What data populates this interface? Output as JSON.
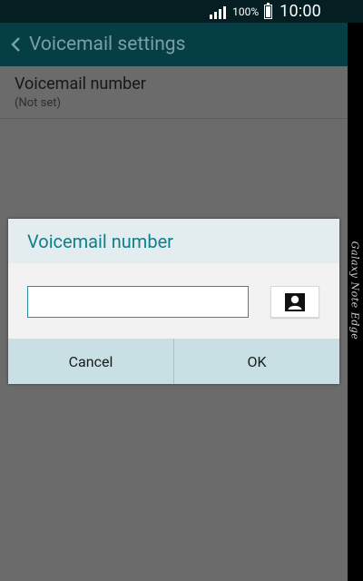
{
  "status_bar": {
    "battery_percent": "100%",
    "time": "10:00"
  },
  "action_bar": {
    "title": "Voicemail settings"
  },
  "settings_list": {
    "items": [
      {
        "title": "Voicemail number",
        "subtitle": "(Not set)"
      }
    ]
  },
  "dialog": {
    "title": "Voicemail number",
    "input_value": "",
    "cancel_label": "Cancel",
    "ok_label": "OK"
  },
  "edge_panel": {
    "label": "Galaxy Note Edge"
  },
  "colors": {
    "status_bar_bg": "#041e22",
    "action_bar_bg": "#063e46",
    "dim_overlay_bg": "#6b6b6b",
    "dialog_title": "#0f7f8c",
    "dialog_buttons_bg": "#c8dfe3",
    "input_border": "#2a8f9c"
  }
}
